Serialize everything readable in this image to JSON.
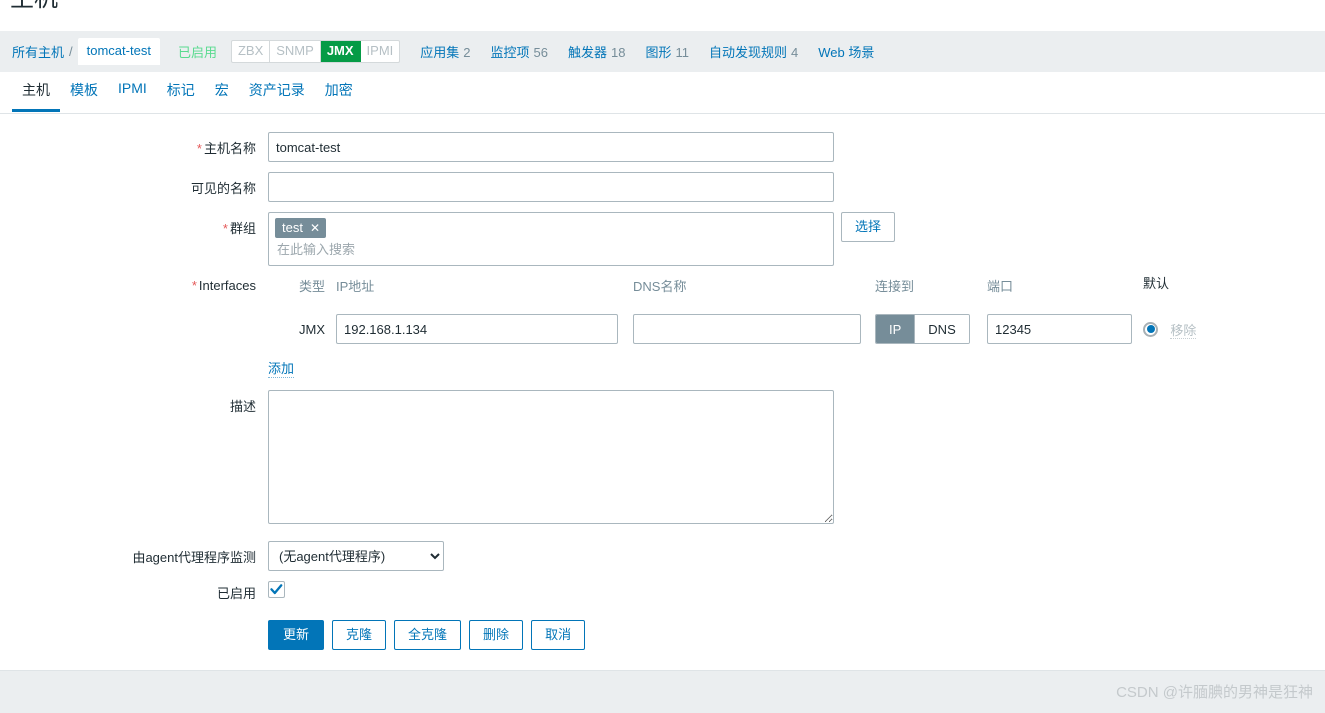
{
  "page": {
    "title": "主机"
  },
  "breadcrumb": {
    "all_hosts": "所有主机",
    "separator": "/",
    "current_host": "tomcat-test",
    "status": "已启用",
    "interface_badges": [
      {
        "label": "ZBX",
        "active": false
      },
      {
        "label": "SNMP",
        "active": false
      },
      {
        "label": "JMX",
        "active": true
      },
      {
        "label": "IPMI",
        "active": false
      }
    ],
    "nav": [
      {
        "label": "应用集",
        "count": "2"
      },
      {
        "label": "监控项",
        "count": "56"
      },
      {
        "label": "触发器",
        "count": "18"
      },
      {
        "label": "图形",
        "count": "11"
      },
      {
        "label": "自动发现规则",
        "count": "4"
      },
      {
        "label": "Web 场景",
        "count": ""
      }
    ]
  },
  "tabs": [
    {
      "label": "主机",
      "active": true
    },
    {
      "label": "模板",
      "active": false
    },
    {
      "label": "IPMI",
      "active": false
    },
    {
      "label": "标记",
      "active": false
    },
    {
      "label": "宏",
      "active": false
    },
    {
      "label": "资产记录",
      "active": false
    },
    {
      "label": "加密",
      "active": false
    }
  ],
  "form": {
    "host_name": {
      "label": "主机名称",
      "required": true,
      "value": "tomcat-test",
      "placeholder": ""
    },
    "visible_name": {
      "label": "可见的名称",
      "required": false,
      "value": "",
      "placeholder": ""
    },
    "groups": {
      "label": "群组",
      "required": true,
      "chips": [
        {
          "label": "test",
          "remove": "✕"
        }
      ],
      "search_placeholder": "在此输入搜索",
      "select_button": "选择"
    },
    "interfaces": {
      "label": "Interfaces",
      "required": true,
      "columns": {
        "type": "类型",
        "ip": "IP地址",
        "dns": "DNS名称",
        "connect_to": "连接到",
        "port": "端口",
        "default": "默认"
      },
      "rows": [
        {
          "type": "JMX",
          "ip": "192.168.1.134",
          "dns": "",
          "connect_to": [
            {
              "label": "IP",
              "selected": true
            },
            {
              "label": "DNS",
              "selected": false
            }
          ],
          "port": "12345",
          "default_selected": true,
          "remove_label": "移除",
          "remove_enabled": false
        }
      ],
      "add_label": "添加"
    },
    "description": {
      "label": "描述",
      "value": "",
      "placeholder": ""
    },
    "proxy": {
      "label": "由agent代理程序监测",
      "selected": "(无agent代理程序)",
      "options": [
        "(无agent代理程序)"
      ]
    },
    "enabled": {
      "label": "已启用",
      "checked": true
    },
    "buttons": [
      {
        "label": "更新",
        "style": "primary"
      },
      {
        "label": "克隆",
        "style": "plain"
      },
      {
        "label": "全克隆",
        "style": "plain"
      },
      {
        "label": "删除",
        "style": "plain"
      },
      {
        "label": "取消",
        "style": "plain"
      }
    ]
  },
  "footer": {
    "watermark": "CSDN @许腼腆的男神是狂神"
  },
  "colors": {
    "accent": "#0275b8",
    "header_bg": "#ebeef0",
    "enabled_green": "#59db8f",
    "jmx_green": "#059b46",
    "required_red": "#e45959",
    "chip_grey": "#768d99",
    "border": "#aab7be"
  }
}
